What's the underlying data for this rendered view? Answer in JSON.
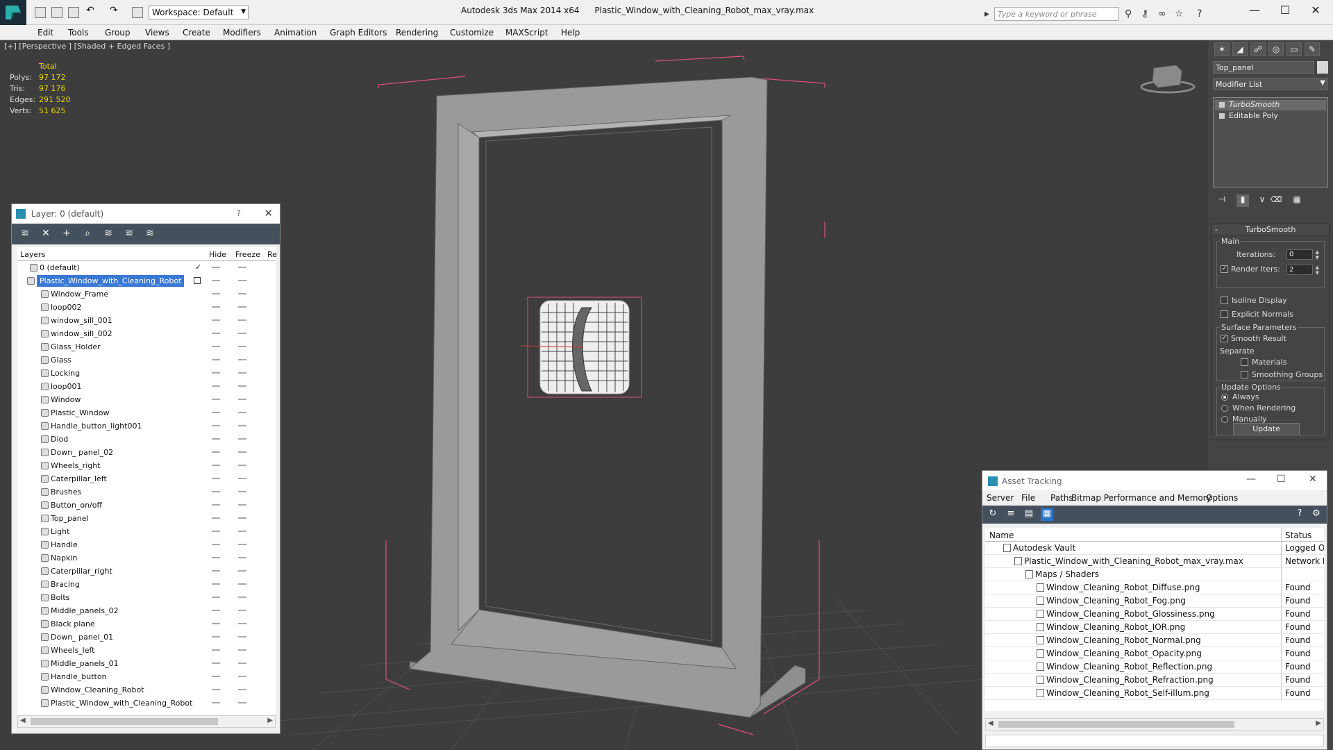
{
  "title_bar": {
    "workspace": "Workspace: Default",
    "app_name": "Autodesk 3ds Max  2014 x64",
    "file_name": "Plastic_Window_with_Cleaning_Robot_max_vray.max",
    "search_placeholder": "Type a keyword or phrase"
  },
  "menu": [
    "Edit",
    "Tools",
    "Group",
    "Views",
    "Create",
    "Modifiers",
    "Animation",
    "Graph Editors",
    "Rendering",
    "Customize",
    "MAXScript",
    "Help"
  ],
  "viewport": {
    "label": "[+] [Perspective ] [Shaded + Edged Faces ]",
    "stats": {
      "header": "Total",
      "polys_label": "Polys:",
      "polys": "97 172",
      "tris_label": "Tris:",
      "tris": "97 176",
      "edges_label": "Edges:",
      "edges": "291 520",
      "verts_label": "Verts:",
      "verts": "51 625"
    }
  },
  "layer_panel": {
    "title": "Layer: 0 (default)",
    "help": "?",
    "columns": {
      "layers": "Layers",
      "hide": "Hide",
      "freeze": "Freeze",
      "render": "Re"
    },
    "default_layer": "0 (default)",
    "selected_layer": "Plastic_Window_with_Cleaning_Robot",
    "objects": [
      "Window_Frame",
      "loop002",
      "window_sill_001",
      "window_sill_002",
      "Glass_Holder",
      "Glass",
      "Locking",
      "loop001",
      "Window",
      "Plastic_Window",
      "Handle_button_light001",
      "Diod",
      "Down_ panel_02",
      "Wheels_right",
      "Caterpillar_left",
      "Brushes",
      "Button_on/off",
      "Top_panel",
      "Light",
      "Handle",
      "Napkin",
      "Caterpillar_right",
      "Bracing",
      "Bolts",
      "Middle_panels_02",
      "Black plane",
      "Down_ panel_01",
      "Wheels_left",
      "Middle_panels_01",
      "Handle_button",
      "Window_Cleaning_Robot",
      "Plastic_Window_with_Cleaning_Robot"
    ]
  },
  "command_panel": {
    "object_name": "Top_panel",
    "modifier_list": "Modifier List",
    "stack": [
      "TurboSmooth",
      "Editable Poly"
    ],
    "rollout_title": "TurboSmooth",
    "main_group": "Main",
    "iterations_label": "Iterations:",
    "iterations": "0",
    "render_iters_label": "Render Iters:",
    "render_iters": "2",
    "render_iters_checked": true,
    "isoline_display": "Isoline Display",
    "explicit_normals": "Explicit Normals",
    "surface_group": "Surface Parameters",
    "smooth_result": "Smooth Result",
    "separate": "Separate",
    "materials": "Materials",
    "smoothing_groups": "Smoothing Groups",
    "update_group": "Update Options",
    "always": "Always",
    "when_rendering": "When Rendering",
    "manually": "Manually",
    "update_button": "Update"
  },
  "asset_tracking": {
    "title": "Asset Tracking",
    "menu": [
      "Server",
      "File",
      "Paths",
      "Bitmap Performance and Memory",
      "Options"
    ],
    "columns": {
      "name": "Name",
      "status": "Status"
    },
    "rows": [
      {
        "name": "Autodesk Vault",
        "status": "Logged Ou"
      },
      {
        "name": "Plastic_Window_with_Cleaning_Robot_max_vray.max",
        "status": "Network Pa"
      },
      {
        "name": "Maps / Shaders",
        "status": ""
      },
      {
        "name": "Window_Cleaning_Robot_Diffuse.png",
        "status": "Found"
      },
      {
        "name": "Window_Cleaning_Robot_Fog.png",
        "status": "Found"
      },
      {
        "name": "Window_Cleaning_Robot_Glossiness.png",
        "status": "Found"
      },
      {
        "name": "Window_Cleaning_Robot_IOR.png",
        "status": "Found"
      },
      {
        "name": "Window_Cleaning_Robot_Normal.png",
        "status": "Found"
      },
      {
        "name": "Window_Cleaning_Robot_Opacity.png",
        "status": "Found"
      },
      {
        "name": "Window_Cleaning_Robot_Reflection.png",
        "status": "Found"
      },
      {
        "name": "Window_Cleaning_Robot_Refraction.png",
        "status": "Found"
      },
      {
        "name": "Window_Cleaning_Robot_Self-illum.png",
        "status": "Found"
      }
    ]
  },
  "colors": {
    "viewport_bg": "#3d3d3d",
    "stats_yellow": "#e6d400",
    "selection_blue": "#3a78d6",
    "bbox_pink": "#e0507a",
    "panel_dark": "#444444"
  }
}
